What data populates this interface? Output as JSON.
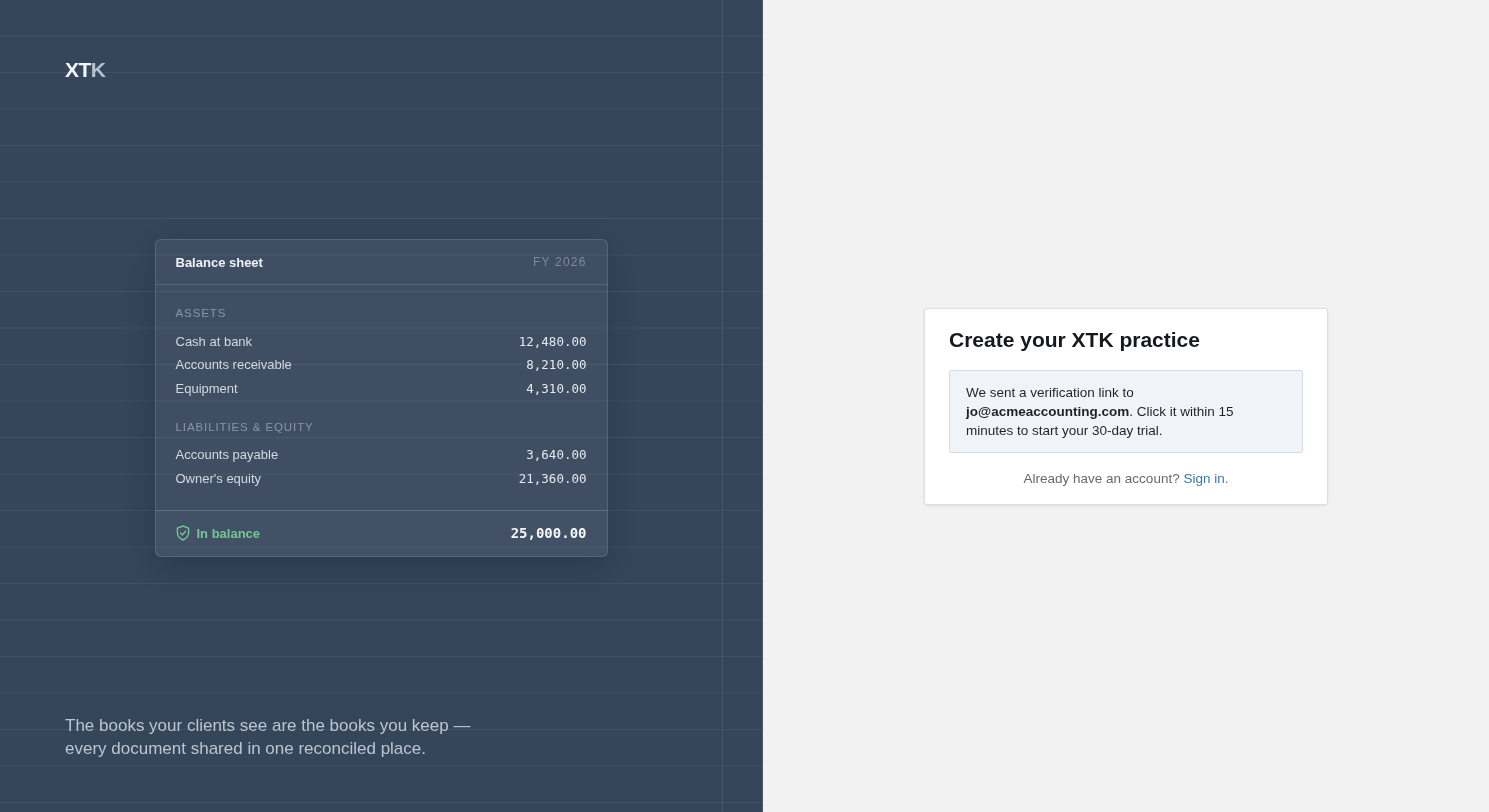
{
  "brand": {
    "logo": {
      "text": "XT",
      "accent": "K"
    },
    "tagline": "The books your clients see are the books you keep — every document shared in one reconciled place."
  },
  "balance_sheet": {
    "title": "Balance sheet",
    "period": "FY 2026",
    "sections": [
      {
        "heading": "ASSETS",
        "rows": [
          {
            "label": "Cash at bank",
            "amount": "12,480.00"
          },
          {
            "label": "Accounts receivable",
            "amount": "8,210.00"
          },
          {
            "label": "Equipment",
            "amount": "4,310.00"
          }
        ]
      },
      {
        "heading": "LIABILITIES & EQUITY",
        "rows": [
          {
            "label": "Accounts payable",
            "amount": "3,640.00"
          },
          {
            "label": "Owner's equity",
            "amount": "21,360.00"
          }
        ]
      }
    ],
    "footer": {
      "balanced": true,
      "status": "In balance",
      "total": "25,000.00"
    }
  },
  "signup": {
    "title": "Create your XTK practice",
    "notice": "We sent a verification link to **jo@acmeaccounting.com**. Click it within 15 minutes to start your 30-day trial.",
    "prompt": "Already have an account?",
    "link": "Sign in."
  }
}
